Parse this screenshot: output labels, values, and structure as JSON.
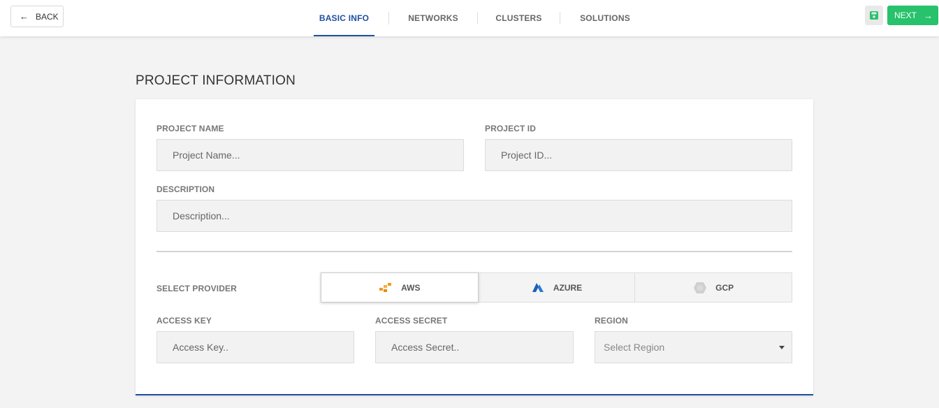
{
  "header": {
    "back_label": "BACK",
    "next_label": "NEXT",
    "tabs": [
      {
        "label": "BASIC INFO",
        "active": true
      },
      {
        "label": "NETWORKS",
        "active": false
      },
      {
        "label": "CLUSTERS",
        "active": false
      },
      {
        "label": "SOLUTIONS",
        "active": false
      }
    ],
    "accent_color": "#1f4fa0",
    "next_color": "#27c26b"
  },
  "section": {
    "title": "PROJECT INFORMATION"
  },
  "form": {
    "project_name": {
      "label": "PROJECT NAME",
      "placeholder": "Project Name...",
      "value": ""
    },
    "project_id": {
      "label": "PROJECT ID",
      "placeholder": "Project ID...",
      "value": ""
    },
    "description": {
      "label": "DESCRIPTION",
      "placeholder": "Description...",
      "value": ""
    },
    "provider": {
      "label": "SELECT PROVIDER",
      "selected": "AWS",
      "options": [
        {
          "label": "AWS",
          "icon": "aws-icon"
        },
        {
          "label": "AZURE",
          "icon": "azure-icon"
        },
        {
          "label": "GCP",
          "icon": "gcp-icon"
        }
      ]
    },
    "access_key": {
      "label": "ACCESS KEY",
      "placeholder": "Access Key..",
      "value": ""
    },
    "access_secret": {
      "label": "ACCESS SECRET",
      "placeholder": "Access Secret..",
      "value": ""
    },
    "region": {
      "label": "REGION",
      "placeholder": "Select Region"
    }
  }
}
